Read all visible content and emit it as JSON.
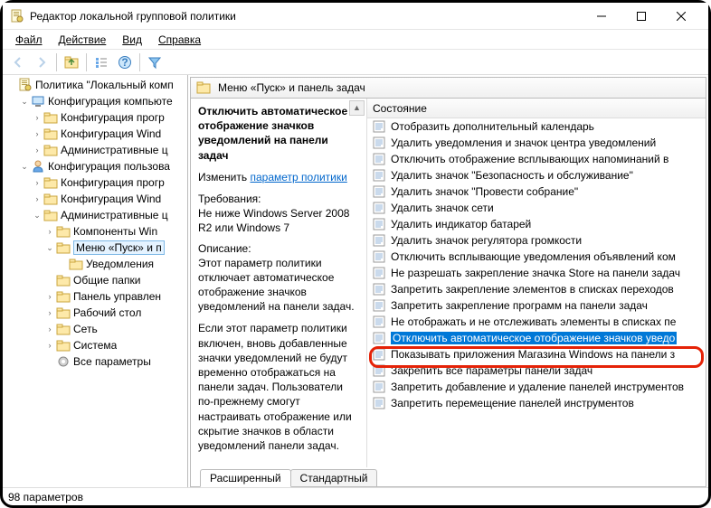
{
  "window": {
    "title": "Редактор локальной групповой политики"
  },
  "menu": {
    "file": "Файл",
    "action": "Действие",
    "view": "Вид",
    "help": "Справка"
  },
  "tree": {
    "root": "Политика \"Локальный комп",
    "compConfig": "Конфигурация компьюте",
    "compSoft": "Конфигурация прогр",
    "compWin": "Конфигурация Wind",
    "compAdmin": "Административные ц",
    "userConfig": "Конфигурация пользова",
    "userSoft": "Конфигурация прогр",
    "userWin": "Конфигурация Wind",
    "userAdmin": "Административные ц",
    "winComp": "Компоненты Win",
    "startMenu": "Меню «Пуск» и п",
    "notifications": "Уведомления",
    "shared": "Общие папки",
    "controlPanel": "Панель управлен",
    "desktop": "Рабочий стол",
    "network": "Сеть",
    "system": "Система",
    "allSettings": "Все параметры"
  },
  "breadcrumb": {
    "text": "Меню «Пуск» и панель задач"
  },
  "detail": {
    "title": "Отключить автоматическое отображение значков уведомлений на панели задач",
    "editLabel": "Изменить",
    "editLink": "параметр политики",
    "reqLabel": "Требования:",
    "reqText": "Не ниже Windows Server 2008 R2 или Windows 7",
    "descLabel": "Описание:",
    "descText": "Этот параметр политики отключает автоматическое отображение значков уведомлений на панели задач.",
    "desc2": "Если этот параметр политики включен, вновь добавленные значки уведомлений не будут временно отображаться на панели задач. Пользователи по-прежнему смогут настраивать отображение или скрытие значков в области уведомлений панели задач."
  },
  "listHeader": "Состояние",
  "listItems": [
    "Отобразить дополнительный календарь",
    "Удалить уведомления и значок центра уведомлений",
    "Отключить отображение всплывающих напоминаний в",
    "Удалить значок \"Безопасность и обслуживание\"",
    "Удалить значок \"Провести собрание\"",
    "Удалить значок сети",
    "Удалить индикатор батарей",
    "Удалить значок регулятора громкости",
    "Отключить всплывающие уведомления объявлений ком",
    "Не разрешать закрепление значка Store на панели задач",
    "Запретить закрепление элементов в списках переходов",
    "Запретить закрепление программ на панели задач",
    "Не отображать и не отслеживать элементы в списках пе",
    "Отключить автоматическое отображение значков уведо",
    "Показывать приложения Магазина Windows на панели з",
    "Закрепить все параметры панели задач",
    "Запретить добавление и удаление панелей инструментов",
    "Запретить перемещение панелей инструментов"
  ],
  "highlightedIndex": 13,
  "tabs": {
    "extended": "Расширенный",
    "standard": "Стандартный"
  },
  "status": "98 параметров"
}
